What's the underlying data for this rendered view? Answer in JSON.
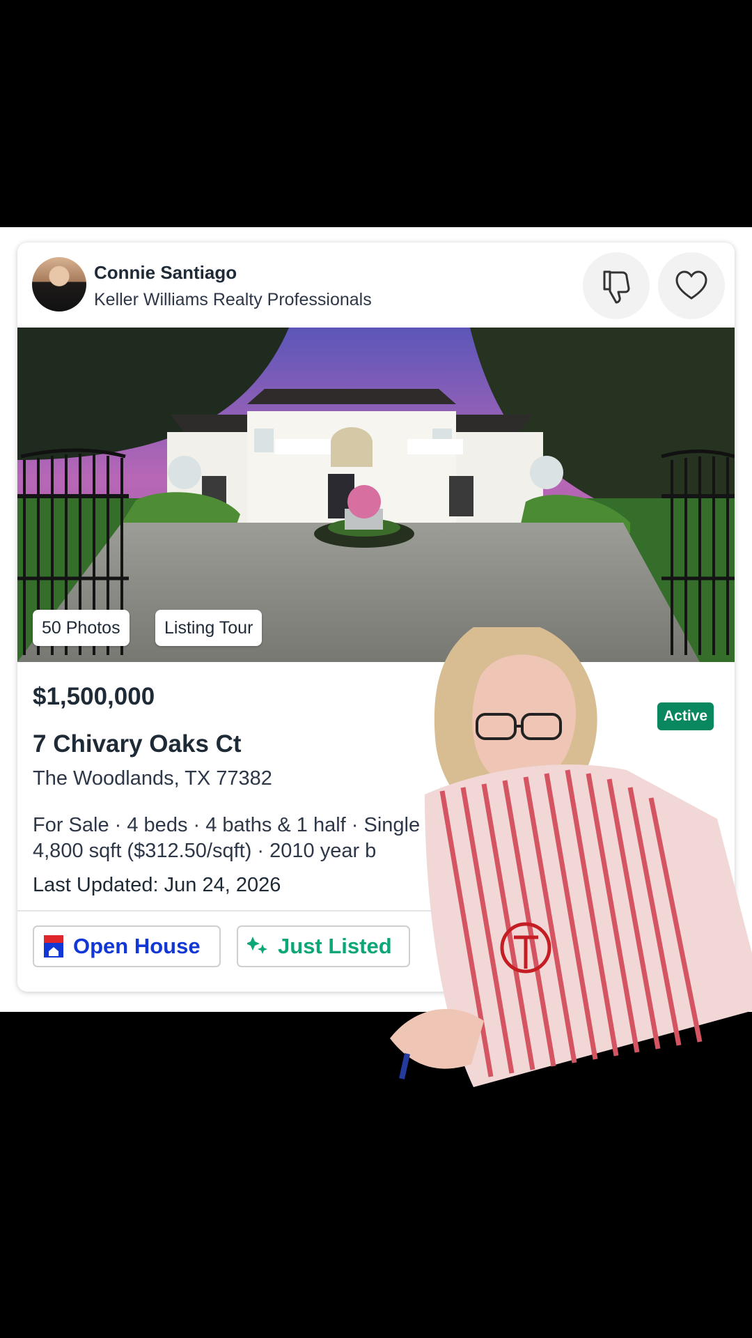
{
  "agent": {
    "name": "Connie Santiago",
    "brokerage": "Keller Williams Realty Professionals",
    "avatar_icon": "agent-photo"
  },
  "actions": {
    "dislike_icon": "thumbs-down-icon",
    "like_icon": "heart-icon"
  },
  "photo": {
    "photos_label": "50 Photos",
    "tour_label": "Listing Tour"
  },
  "listing": {
    "price": "$1,500,000",
    "status": "Active",
    "address": "7 Chivary Oaks Ct",
    "city": "The Woodlands, TX 77382",
    "details_line1": "For Sale · 4 beds · 4 baths & 1 half · Single",
    "details_line2": "4,800 sqft ($312.50/sqft) · 2010 year b",
    "updated": "Last Updated: Jun 24, 2026"
  },
  "tags": {
    "open_house": "Open House",
    "just_listed": "Just Listed"
  },
  "colors": {
    "active_badge": "#09875e",
    "open_house": "#1138d6",
    "just_listed": "#0ca778"
  }
}
